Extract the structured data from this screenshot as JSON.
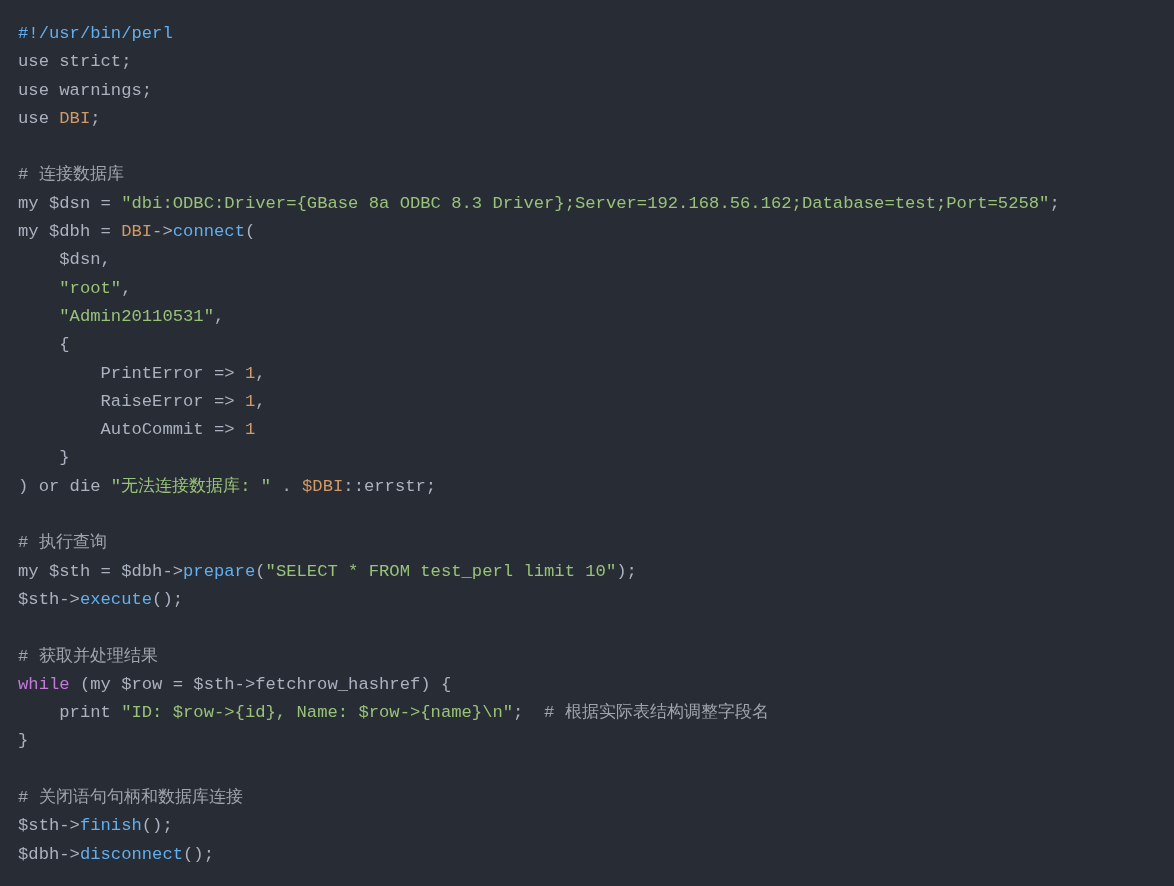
{
  "code_block": {
    "lines": [
      {
        "kind": "code",
        "tokens": [
          {
            "text": "#!/usr/bin/perl",
            "kind": "meta"
          }
        ]
      },
      {
        "kind": "code",
        "tokens": [
          {
            "text": "use strict;",
            "kind": "plain"
          }
        ]
      },
      {
        "kind": "code",
        "tokens": [
          {
            "text": "use warnings;",
            "kind": "plain"
          }
        ]
      },
      {
        "kind": "code",
        "tokens": [
          {
            "text": "use ",
            "kind": "plain"
          },
          {
            "text": "DBI",
            "kind": "class"
          },
          {
            "text": ";",
            "kind": "plain"
          }
        ]
      },
      {
        "kind": "blank"
      },
      {
        "kind": "code",
        "tokens": [
          {
            "text": "# 连接数据库",
            "kind": "comment"
          }
        ]
      },
      {
        "kind": "code",
        "tokens": [
          {
            "text": "my $dsn = ",
            "kind": "plain"
          },
          {
            "text": "\"dbi:ODBC:Driver={GBase 8a ODBC 8.3 Driver};Server=192.168.56.162;Database=test;Port=5258\"",
            "kind": "string"
          },
          {
            "text": ";",
            "kind": "plain"
          }
        ]
      },
      {
        "kind": "code",
        "tokens": [
          {
            "text": "my $dbh = ",
            "kind": "plain"
          },
          {
            "text": "DBI",
            "kind": "class"
          },
          {
            "text": "->",
            "kind": "plain"
          },
          {
            "text": "connect",
            "kind": "function"
          },
          {
            "text": "(",
            "kind": "plain"
          }
        ]
      },
      {
        "kind": "code",
        "tokens": [
          {
            "text": "    $dsn,",
            "kind": "plain"
          }
        ]
      },
      {
        "kind": "code",
        "tokens": [
          {
            "text": "    \"root\"",
            "kind": "string"
          },
          {
            "text": ",",
            "kind": "plain"
          }
        ]
      },
      {
        "kind": "code",
        "tokens": [
          {
            "text": "    \"Admin20110531\"",
            "kind": "string"
          },
          {
            "text": ",",
            "kind": "plain"
          }
        ]
      },
      {
        "kind": "code",
        "tokens": [
          {
            "text": "    {",
            "kind": "plain"
          }
        ]
      },
      {
        "kind": "code",
        "tokens": [
          {
            "text": "        PrintError => ",
            "kind": "plain"
          },
          {
            "text": "1",
            "kind": "number"
          },
          {
            "text": ",",
            "kind": "plain"
          }
        ]
      },
      {
        "kind": "code",
        "tokens": [
          {
            "text": "        RaiseError => ",
            "kind": "plain"
          },
          {
            "text": "1",
            "kind": "number"
          },
          {
            "text": ",",
            "kind": "plain"
          }
        ]
      },
      {
        "kind": "code",
        "tokens": [
          {
            "text": "        AutoCommit => ",
            "kind": "plain"
          },
          {
            "text": "1",
            "kind": "number"
          }
        ]
      },
      {
        "kind": "code",
        "tokens": [
          {
            "text": "    }",
            "kind": "plain"
          }
        ]
      },
      {
        "kind": "code",
        "tokens": [
          {
            "text": ") or die ",
            "kind": "plain"
          },
          {
            "text": "\"无法连接数据库: \"",
            "kind": "string"
          },
          {
            "text": " . ",
            "kind": "plain"
          },
          {
            "text": "$DBI",
            "kind": "class"
          },
          {
            "text": "::errstr;",
            "kind": "plain"
          }
        ]
      },
      {
        "kind": "blank"
      },
      {
        "kind": "code",
        "tokens": [
          {
            "text": "# 执行查询",
            "kind": "comment"
          }
        ]
      },
      {
        "kind": "code",
        "tokens": [
          {
            "text": "my $sth = $dbh->",
            "kind": "plain"
          },
          {
            "text": "prepare",
            "kind": "function"
          },
          {
            "text": "(",
            "kind": "plain"
          },
          {
            "text": "\"SELECT * FROM test_perl limit 10\"",
            "kind": "string"
          },
          {
            "text": ");",
            "kind": "plain"
          }
        ]
      },
      {
        "kind": "code",
        "tokens": [
          {
            "text": "$sth->",
            "kind": "plain"
          },
          {
            "text": "execute",
            "kind": "function"
          },
          {
            "text": "();",
            "kind": "plain"
          }
        ]
      },
      {
        "kind": "blank"
      },
      {
        "kind": "code",
        "tokens": [
          {
            "text": "# 获取并处理结果",
            "kind": "comment"
          }
        ]
      },
      {
        "kind": "code",
        "tokens": [
          {
            "text": "while",
            "kind": "keyword"
          },
          {
            "text": " (my $row = $sth->fetchrow_hashref) {",
            "kind": "plain"
          }
        ]
      },
      {
        "kind": "code",
        "tokens": [
          {
            "text": "    print ",
            "kind": "plain"
          },
          {
            "text": "\"ID: $row->{id}, Name: $row->{name}\\n\"",
            "kind": "string"
          },
          {
            "text": ";  ",
            "kind": "plain"
          },
          {
            "text": "# 根据实际表结构调整字段名",
            "kind": "comment"
          }
        ]
      },
      {
        "kind": "code",
        "tokens": [
          {
            "text": "}",
            "kind": "plain"
          }
        ]
      },
      {
        "kind": "blank"
      },
      {
        "kind": "code",
        "tokens": [
          {
            "text": "# 关闭语句句柄和数据库连接",
            "kind": "comment"
          }
        ]
      },
      {
        "kind": "code",
        "tokens": [
          {
            "text": "$sth->",
            "kind": "plain"
          },
          {
            "text": "finish",
            "kind": "function"
          },
          {
            "text": "();",
            "kind": "plain"
          }
        ]
      },
      {
        "kind": "code",
        "tokens": [
          {
            "text": "$dbh->",
            "kind": "plain"
          },
          {
            "text": "disconnect",
            "kind": "function"
          },
          {
            "text": "();",
            "kind": "plain"
          }
        ]
      }
    ]
  }
}
